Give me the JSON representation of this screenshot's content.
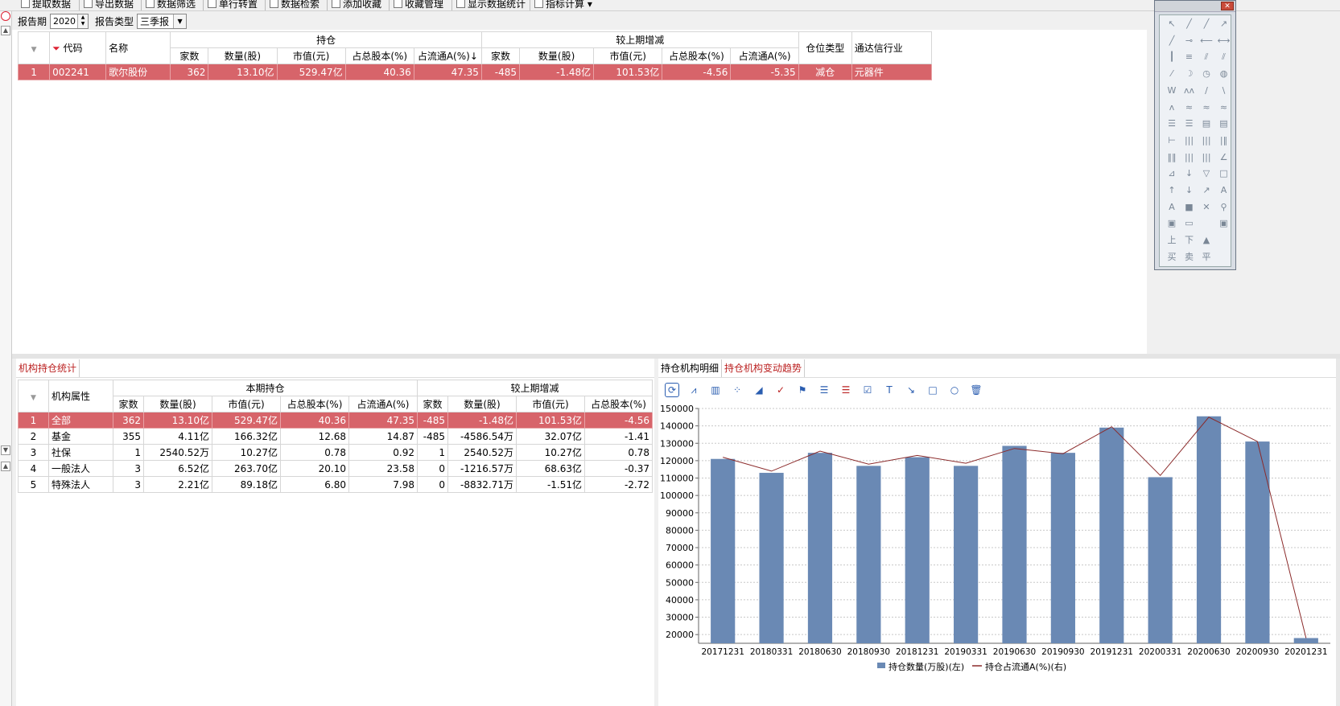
{
  "toolbar": {
    "buttons": [
      "提取数据",
      "导出数据",
      "数据筛选",
      "单行转置",
      "数据检索",
      "添加收藏",
      "收藏管理",
      "显示数据统计",
      "指标计算 ▾"
    ]
  },
  "filters": {
    "period_label": "报告期",
    "period_value": "2020",
    "type_label": "报告类型",
    "type_value": "三季报"
  },
  "main_table": {
    "group_hold": "持仓",
    "group_change": "较上期增减",
    "col_code": "代码",
    "col_name": "名称",
    "col_position_type": "仓位类型",
    "col_industry": "通达信行业",
    "sub_cols": [
      "家数",
      "数量(股)",
      "市值(元)",
      "占总股本(%)",
      "占流通A(%)↓",
      "家数",
      "数量(股)",
      "市值(元)",
      "占总股本(%)",
      "占流通A(%)"
    ],
    "rows": [
      [
        "1",
        "002241",
        "歌尔股份",
        "362",
        "13.10亿",
        "529.47亿",
        "40.36",
        "47.35",
        "-485",
        "-1.48亿",
        "101.53亿",
        "-4.56",
        "-5.35",
        "减仓",
        "元器件"
      ]
    ]
  },
  "lower_left": {
    "tab": "机构持仓统计",
    "group_hold": "本期持仓",
    "group_change": "较上期增减",
    "col_attr": "机构属性",
    "sub_cols": [
      "家数",
      "数量(股)",
      "市值(元)",
      "占总股本(%)",
      "占流通A(%)",
      "家数",
      "数量(股)",
      "市值(元)",
      "占总股本(%)"
    ],
    "rows": [
      [
        "1",
        "全部",
        "362",
        "13.10亿",
        "529.47亿",
        "40.36",
        "47.35",
        "-485",
        "-1.48亿",
        "101.53亿",
        "-4.56"
      ],
      [
        "2",
        "基金",
        "355",
        "4.11亿",
        "166.32亿",
        "12.68",
        "14.87",
        "-485",
        "-4586.54万",
        "32.07亿",
        "-1.41"
      ],
      [
        "3",
        "社保",
        "1",
        "2540.52万",
        "10.27亿",
        "0.78",
        "0.92",
        "1",
        "2540.52万",
        "10.27亿",
        "0.78"
      ],
      [
        "4",
        "一般法人",
        "3",
        "6.52亿",
        "263.70亿",
        "20.10",
        "23.58",
        "0",
        "-1216.57万",
        "68.63亿",
        "-0.37"
      ],
      [
        "5",
        "特殊法人",
        "3",
        "2.21亿",
        "89.18亿",
        "6.80",
        "7.98",
        "0",
        "-8832.71万",
        "-1.51亿",
        "-2.72"
      ]
    ]
  },
  "lower_right": {
    "tab_detail": "持仓机构明细",
    "tab_trend": "持仓机构变动趋势",
    "tool_icons": [
      "refresh-icon",
      "line-chart-icon",
      "bar-chart-icon",
      "scatter-icon",
      "area-chart-icon",
      "trend-icon",
      "flag-icon",
      "list-icon",
      "list-red-icon",
      "check-box-icon",
      "text-icon",
      "arrow-icon",
      "rect-icon",
      "circle-icon",
      "trash-icon"
    ],
    "legend_bar": "持仓数量(万股)(左)",
    "legend_line": "持仓占流通A(%)(右)"
  },
  "chart_data": {
    "type": "bar",
    "categories": [
      "20171231",
      "20180331",
      "20180630",
      "20180930",
      "20181231",
      "20190331",
      "20190630",
      "20190930",
      "20191231",
      "20200331",
      "20200630",
      "20200930",
      "20201231"
    ],
    "series": [
      {
        "name": "持仓数量(万股)(左)",
        "type": "bar",
        "values": [
          121000,
          113000,
          124500,
          117000,
          122000,
          117000,
          128500,
          124500,
          139000,
          110500,
          145500,
          131000,
          18000
        ]
      },
      {
        "name": "持仓占流通A(%)(右)",
        "type": "line",
        "values": [
          122000,
          114000,
          125500,
          118000,
          123000,
          118500,
          127000,
          124000,
          139500,
          111500,
          145000,
          131000,
          18000
        ]
      }
    ],
    "yticks": [
      20000,
      30000,
      40000,
      50000,
      60000,
      70000,
      80000,
      90000,
      100000,
      110000,
      120000,
      130000,
      140000,
      150000
    ],
    "ylim": [
      15000,
      150000
    ],
    "bar_color": "#6a89b4",
    "line_color": "#8b2a2a",
    "grid": true,
    "legend": "bottom"
  },
  "colors": {
    "highlight_row": "#d7646a",
    "accent_tab": "#b22222"
  }
}
